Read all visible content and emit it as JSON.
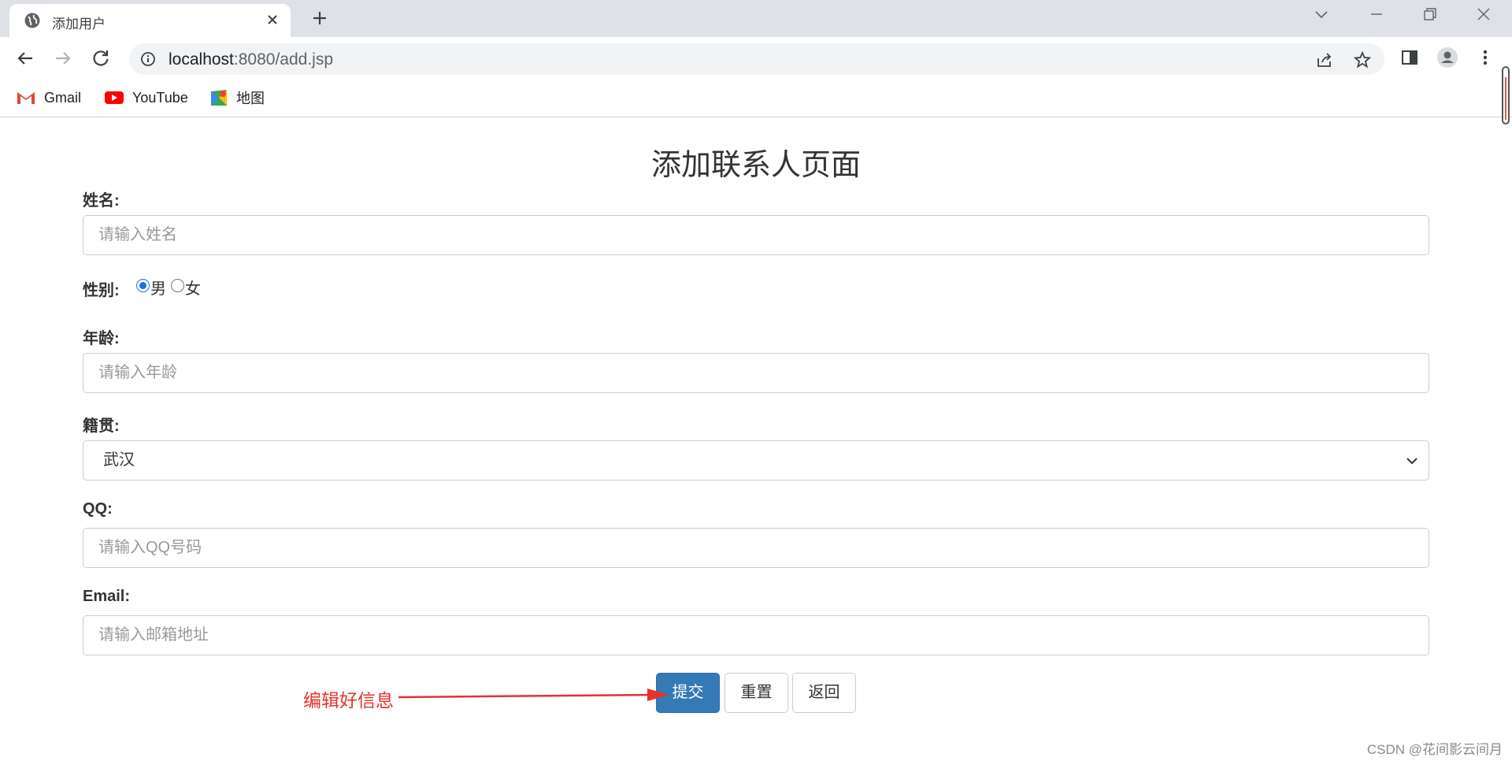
{
  "browser": {
    "tab_title": "添加用户",
    "url_host": "localhost",
    "url_rest": ":8080/add.jsp",
    "bookmarks": [
      "Gmail",
      "YouTube",
      "地图"
    ]
  },
  "page": {
    "title": "添加联系人页面",
    "name": {
      "label": "姓名:",
      "placeholder": "请输入姓名"
    },
    "gender": {
      "label": "性别:",
      "options": [
        "男",
        "女"
      ],
      "selected": "男"
    },
    "age": {
      "label": "年龄:",
      "placeholder": "请输入年龄"
    },
    "hometown": {
      "label": "籍贯:",
      "value": "武汉"
    },
    "qq": {
      "label": "QQ:",
      "placeholder": "请输入QQ号码"
    },
    "email": {
      "label": "Email:",
      "placeholder": "请输入邮箱地址"
    },
    "buttons": {
      "submit": "提交",
      "reset": "重置",
      "back": "返回"
    }
  },
  "annotation": {
    "text": "编辑好信息",
    "color": "#e5322d"
  },
  "watermark": "CSDN @花间影云间月",
  "colors": {
    "primary_button": "#337ab7",
    "radio_checked": "#1a73e8"
  }
}
